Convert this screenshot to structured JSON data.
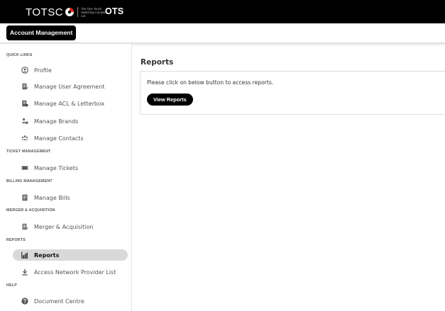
{
  "header": {
    "logo_text": "TOTSC",
    "logo_tagline": "The One Touch Switching Company Ltd",
    "app_name": "OTS"
  },
  "subheader": {
    "account_button": "Account Management"
  },
  "sidebar": {
    "sections": [
      {
        "heading": "QUICK LINKS",
        "items": [
          {
            "label": "Profile",
            "icon": "user-circle-icon"
          },
          {
            "label": "Manage User Agreement",
            "icon": "document-edit-icon"
          },
          {
            "label": "Manage ACL & Letterbox",
            "icon": "document-stack-icon"
          },
          {
            "label": "Manage Brands",
            "icon": "brand-people-icon"
          },
          {
            "label": "Manage Contacts",
            "icon": "contacts-group-icon"
          }
        ]
      },
      {
        "heading": "TICKET MANAGEMENT",
        "items": [
          {
            "label": "Manage Tickets",
            "icon": "ticket-icon"
          }
        ]
      },
      {
        "heading": "BILLING MANAGEMENT",
        "items": [
          {
            "label": "Manage Bills",
            "icon": "bill-icon"
          }
        ]
      },
      {
        "heading": "MERGER & ACQUISITION",
        "items": [
          {
            "label": "Merger & Acquisition",
            "icon": "document-edit-icon"
          }
        ]
      },
      {
        "heading": "REPORTS",
        "items": [
          {
            "label": "Reports",
            "icon": "chart-icon",
            "active": true
          },
          {
            "label": "Access Network Provider List",
            "icon": "download-icon"
          }
        ]
      },
      {
        "heading": "HELP",
        "items": [
          {
            "label": "Document Centre",
            "icon": "help-circle-icon"
          }
        ]
      }
    ]
  },
  "main": {
    "title": "Reports",
    "panel_text": "Please click on below button to access reports.",
    "view_button": "View Reports"
  },
  "colors": {
    "topbar": "#000000",
    "active_item": "#d9d9d9",
    "text_muted": "#555555"
  }
}
